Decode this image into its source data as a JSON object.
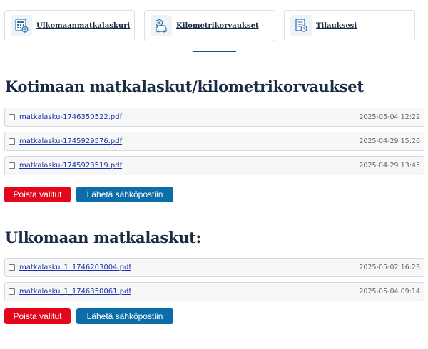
{
  "nav": [
    {
      "label": "Ulkomaanmatkalaskuri",
      "icon": "globe-calculator-icon"
    },
    {
      "label": "Kilometrikorvaukset",
      "icon": "car-calculator-icon"
    },
    {
      "label": "Tilauksesi",
      "icon": "order-document-icon"
    }
  ],
  "domestic": {
    "title": "Kotimaan matkalaskut/kilometrikorvaukset",
    "files": [
      {
        "name": "matkalasku-1746350522.pdf",
        "date": "2025-05-04 12:22"
      },
      {
        "name": "matkalasku-1745929576.pdf",
        "date": "2025-04-29 15:26"
      },
      {
        "name": "matkalasku-1745923519.pdf",
        "date": "2025-04-29 13:45"
      }
    ],
    "delete_label": "Poista valitut",
    "send_label": "Lähetä sähköpostiin"
  },
  "foreign": {
    "title": "Ulkomaan matkalaskut:",
    "files": [
      {
        "name": "matkalasku_1_1746203004.pdf",
        "date": "2025-05-02 16:23"
      },
      {
        "name": "matkalasku_1_1746350061.pdf",
        "date": "2025-05-04 09:14"
      }
    ],
    "delete_label": "Poista valitut",
    "send_label": "Lähetä sähköpostiin"
  },
  "colors": {
    "delete": "#e3071b",
    "send": "#0c6ea8",
    "heading": "#1a2b45",
    "link": "#1a33a8"
  }
}
